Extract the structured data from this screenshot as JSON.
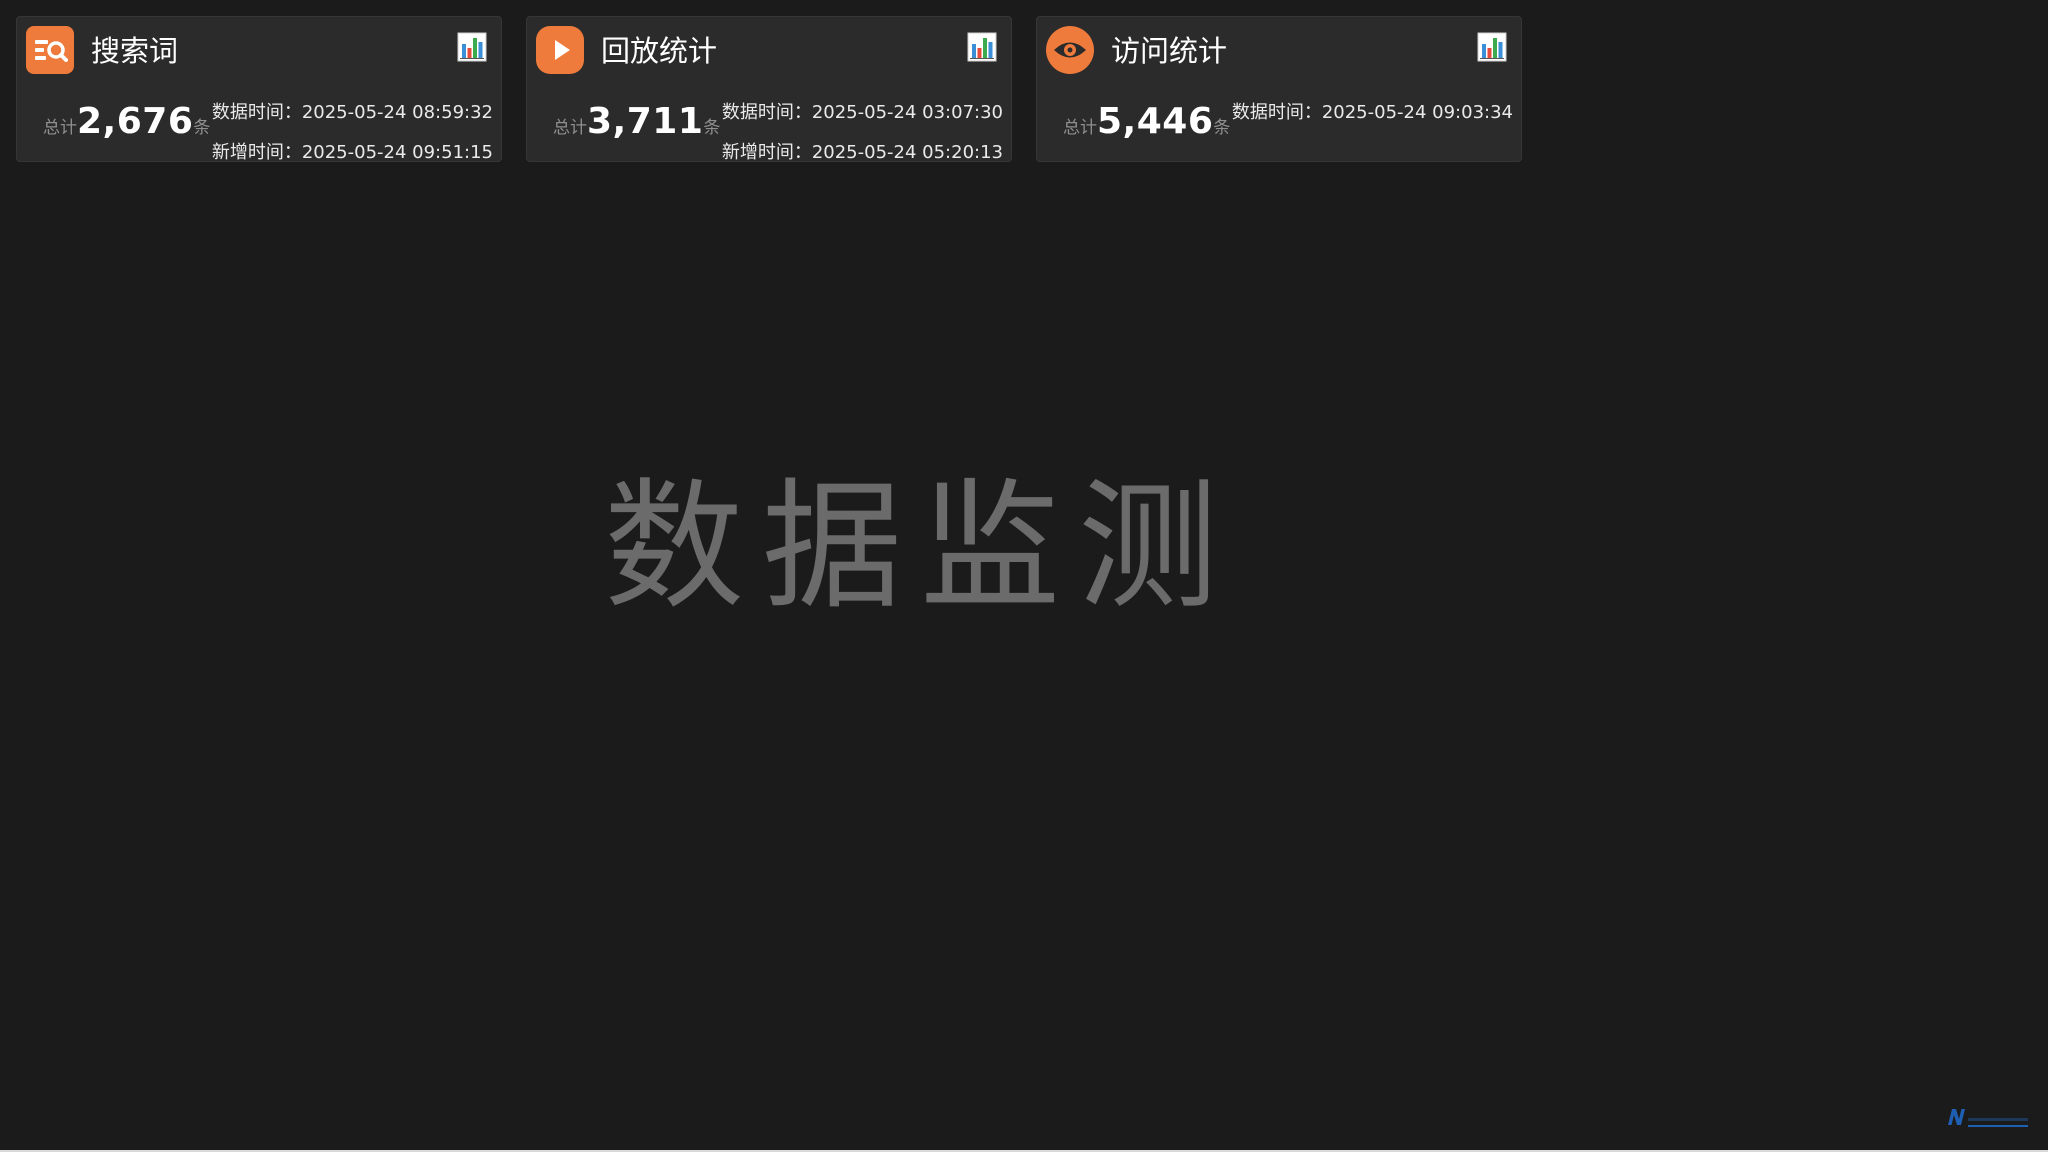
{
  "colors": {
    "background": "#1b1b1b",
    "card_background": "#2b2b2b",
    "accent_orange": "#ee7a3c",
    "watermark_text": "#6b6b6b"
  },
  "cards": [
    {
      "icon": "search-list-icon",
      "title": "搜索词",
      "total_label": "总计",
      "total_value": "2,676",
      "unit": "条",
      "data_time_label": "数据时间：",
      "data_time": "2025-05-24 08:59:32",
      "new_time_label": "新增时间：",
      "new_time": "2025-05-24 09:51:15",
      "chart_icon": "bar-chart-icon"
    },
    {
      "icon": "play-icon",
      "title": "回放统计",
      "total_label": "总计",
      "total_value": "3,711",
      "unit": "条",
      "data_time_label": "数据时间：",
      "data_time": "2025-05-24 03:07:30",
      "new_time_label": "新增时间：",
      "new_time": "2025-05-24 05:20:13",
      "chart_icon": "bar-chart-icon"
    },
    {
      "icon": "eye-icon",
      "title": "访问统计",
      "total_label": "总计",
      "total_value": "5,446",
      "unit": "条",
      "data_time_label": "数据时间：",
      "data_time": "2025-05-24 09:03:34",
      "chart_icon": "bar-chart-icon"
    }
  ],
  "main": {
    "watermark_title": "数据监测"
  }
}
